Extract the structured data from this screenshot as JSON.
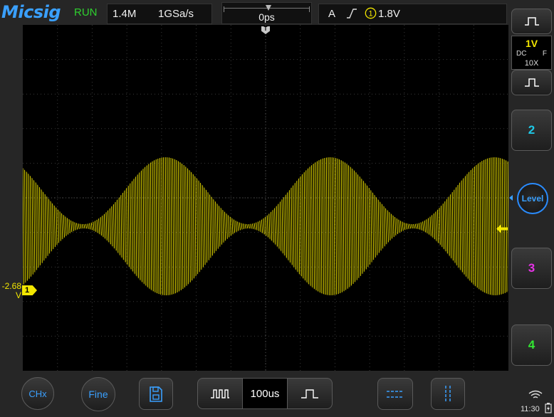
{
  "header": {
    "logo": "Micsig",
    "run_state": "RUN",
    "memory_depth": "1.4M",
    "sample_rate": "1GSa/s",
    "horizontal_delay": "0ps",
    "trigger_mode": "A",
    "trigger_edge_icon": "rising-edge-icon",
    "trigger_source": "1",
    "trigger_level": "1.8V"
  },
  "screen": {
    "trigger_position_marker": "T",
    "ch1_offset_line1": "-2.68",
    "ch1_offset_line2": "V",
    "ch1_marker": "1",
    "trace_color": "#f2e600",
    "grid_color": "#3a3a3a"
  },
  "right_panel": {
    "ch1_scale": "1V",
    "ch1_coupling": "DC",
    "ch1_bandwidth": "F",
    "ch1_probe": "10X",
    "ch2_label": "2",
    "ch3_label": "3",
    "ch4_label": "4",
    "level_label": "Level",
    "colors": {
      "ch1": "#f2e600",
      "ch2": "#1ec8e6",
      "ch3": "#e633e6",
      "ch4": "#33e633",
      "accent": "#3aa0ff"
    }
  },
  "bottom_bar": {
    "chx_label": "CHx",
    "fine_label": "Fine",
    "timebase": "100us",
    "clock": "11:30"
  }
}
